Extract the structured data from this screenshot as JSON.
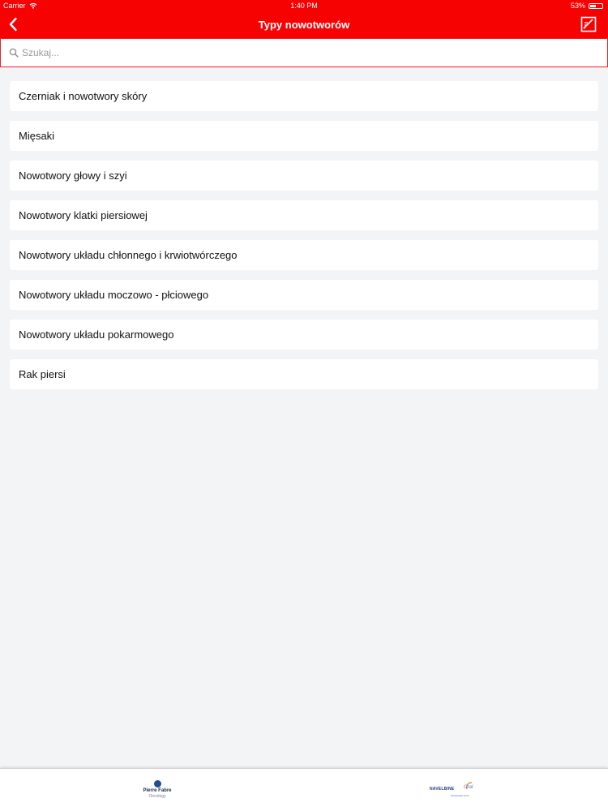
{
  "status_bar": {
    "carrier": "Carrier",
    "time": "1:40 PM",
    "battery": "53%",
    "battery_level": 0.53
  },
  "nav_bar": {
    "title": "Typy nowotworów",
    "back_icon": "chevron-left-icon",
    "action_icon": "document-pen-icon"
  },
  "search": {
    "placeholder": "Szukaj..."
  },
  "list": {
    "items": [
      {
        "label": "Czerniak i nowotwory skóry"
      },
      {
        "label": "Mięsaki"
      },
      {
        "label": "Nowotwory głowy i szyi"
      },
      {
        "label": "Nowotwory klatki piersiowej"
      },
      {
        "label": "Nowotwory układu chłonnego i krwiotwórczego"
      },
      {
        "label": "Nowotwory układu moczowo - płciowego"
      },
      {
        "label": "Nowotwory układu pokarmowego"
      },
      {
        "label": "Rak piersi"
      }
    ]
  },
  "footer": {
    "left_logo": {
      "name": "Pierre Fabre",
      "sub": "Oncology"
    },
    "right_logo": {
      "name": "NAVELBINE",
      "oral": "Oral",
      "tagline": "Akceptacja życia"
    }
  },
  "colors": {
    "brand_red": "#f70202",
    "background": "#f2f4f6"
  }
}
